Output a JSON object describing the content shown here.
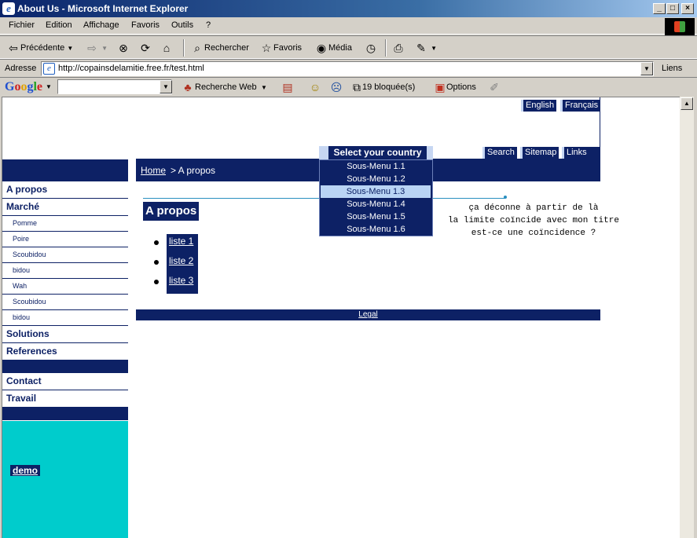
{
  "window": {
    "title": "About Us - Microsoft Internet Explorer",
    "minimize": "_",
    "maximize": "□",
    "close": "×"
  },
  "menu": [
    "Fichier",
    "Edition",
    "Affichage",
    "Favoris",
    "Outils",
    "?"
  ],
  "toolbar": {
    "back": "Précédente",
    "search": "Rechercher",
    "favorites": "Favoris",
    "media": "Média"
  },
  "address": {
    "label": "Adresse",
    "url": "http://copainsdelamitie.free.fr/test.html",
    "links": "Liens"
  },
  "googlebar": {
    "logo": "Google",
    "search_value": "",
    "web_search": "Recherche Web",
    "blocked": "19 bloquée(s)",
    "options": "Options"
  },
  "site": {
    "lang_en": "English",
    "lang_fr": "Français",
    "nav": [
      "Search",
      "Sitemap",
      "Links"
    ],
    "country": {
      "label": "Select your country",
      "items": [
        "Sous-Menu 1.1",
        "Sous-Menu 1.2",
        "Sous-Menu 1.3",
        "Sous-Menu 1.4",
        "Sous-Menu 1.5",
        "Sous-Menu 1.6"
      ],
      "active_index": 2
    },
    "breadcrumb": {
      "home": "Home",
      "rest": "> A propos"
    },
    "sidebar": {
      "a_propos": "A propos",
      "marche": "Marché",
      "sub": [
        "Pomme",
        "Poire",
        "Scoubidou",
        "bidou",
        "Wah",
        "Scoubidou",
        "bidou"
      ],
      "solutions": "Solutions",
      "references": "References",
      "contact": "Contact",
      "travail": "Travail",
      "demo": "demo"
    },
    "heading": "A propos",
    "list": [
      "liste 1",
      "liste 2",
      "liste 3"
    ],
    "note": "ça déconne à partir de là\nla limite coïncide avec mon titre\nest-ce une coïncidence ?",
    "footer": "Legal",
    "colors": {
      "navy": "#0d2165",
      "teal": "#00cccc",
      "highlight": "#b9d4f4"
    }
  }
}
